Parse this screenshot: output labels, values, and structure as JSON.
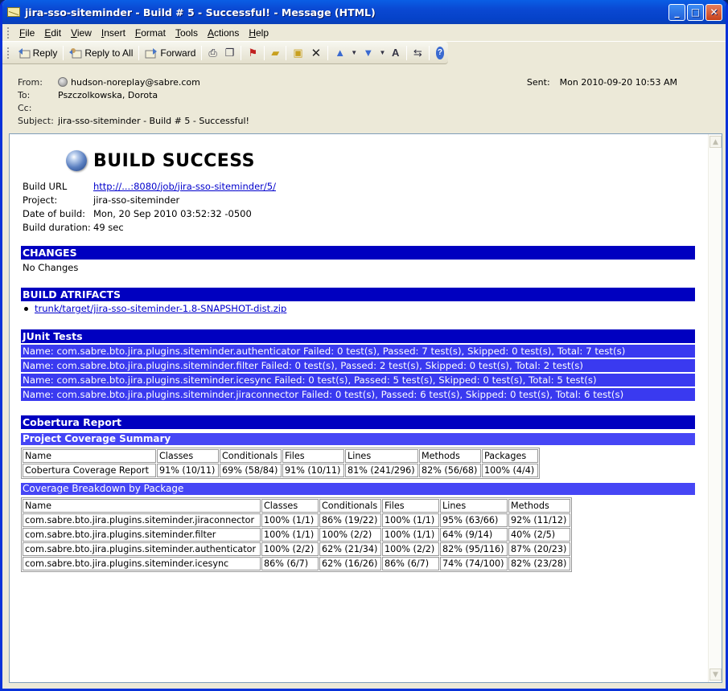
{
  "window": {
    "title": "jira-sso-siteminder - Build # 5 - Successful! - Message (HTML)"
  },
  "menu": [
    "File",
    "Edit",
    "View",
    "Insert",
    "Format",
    "Tools",
    "Actions",
    "Help"
  ],
  "toolbar": {
    "reply": "Reply",
    "reply_all": "Reply to All",
    "forward": "Forward"
  },
  "headers": {
    "from_label": "From:",
    "from": "hudson-noreplay@sabre.com",
    "to_label": "To:",
    "to": "Pszczolkowska, Dorota",
    "cc_label": "Cc:",
    "cc": "",
    "subject_label": "Subject:",
    "subject": "jira-sso-siteminder - Build # 5 - Successful!",
    "sent_label": "Sent:",
    "sent": "Mon 2010-09-20 10:53 AM"
  },
  "build": {
    "title": "BUILD SUCCESS",
    "url_label": "Build URL",
    "url": "http://...:8080/job/jira-sso-siteminder/5/",
    "project_label": "Project:",
    "project": "jira-sso-siteminder",
    "date_label": "Date of build:",
    "date": "Mon, 20 Sep 2010 03:52:32 -0500",
    "duration_label": "Build duration:",
    "duration": "49 sec"
  },
  "changes": {
    "title": "CHANGES",
    "text": "No Changes"
  },
  "artifacts": {
    "title": "BUILD ATRIFACTS",
    "items": [
      "trunk/target/jira-sso-siteminder-1.8-SNAPSHOT-dist.zip"
    ]
  },
  "junit": {
    "title": "JUnit Tests",
    "rows": [
      "Name: com.sabre.bto.jira.plugins.siteminder.authenticator Failed: 0 test(s), Passed: 7 test(s), Skipped: 0 test(s), Total: 7 test(s)",
      "Name: com.sabre.bto.jira.plugins.siteminder.filter Failed: 0 test(s), Passed: 2 test(s), Skipped: 0 test(s), Total: 2 test(s)",
      "Name: com.sabre.bto.jira.plugins.siteminder.icesync Failed: 0 test(s), Passed: 5 test(s), Skipped: 0 test(s), Total: 5 test(s)",
      "Name: com.sabre.bto.jira.plugins.siteminder.jiraconnector Failed: 0 test(s), Passed: 6 test(s), Skipped: 0 test(s), Total: 6 test(s)"
    ]
  },
  "cobertura": {
    "title": "Cobertura Report",
    "summary_title": "Project Coverage Summary",
    "summary_headers": [
      "Name",
      "Classes",
      "Conditionals",
      "Files",
      "Lines",
      "Methods",
      "Packages"
    ],
    "summary_row": [
      "Cobertura Coverage Report",
      "91% (10/11)",
      "69% (58/84)",
      "91% (10/11)",
      "81% (241/296)",
      "82% (56/68)",
      "100% (4/4)"
    ],
    "breakdown_title": "Coverage Breakdown by Package",
    "breakdown_headers": [
      "Name",
      "Classes",
      "Conditionals",
      "Files",
      "Lines",
      "Methods"
    ],
    "breakdown_rows": [
      [
        "com.sabre.bto.jira.plugins.siteminder.jiraconnector",
        "100% (1/1)",
        "86% (19/22)",
        "100% (1/1)",
        "95% (63/66)",
        "92% (11/12)"
      ],
      [
        "com.sabre.bto.jira.plugins.siteminder.filter",
        "100% (1/1)",
        "100% (2/2)",
        "100% (1/1)",
        "64% (9/14)",
        "40% (2/5)"
      ],
      [
        "com.sabre.bto.jira.plugins.siteminder.authenticator",
        "100% (2/2)",
        "62% (21/34)",
        "100% (2/2)",
        "82% (95/116)",
        "87% (20/23)"
      ],
      [
        "com.sabre.bto.jira.plugins.siteminder.icesync",
        "86% (6/7)",
        "62% (16/26)",
        "86% (6/7)",
        "74% (74/100)",
        "82% (23/28)"
      ]
    ]
  }
}
